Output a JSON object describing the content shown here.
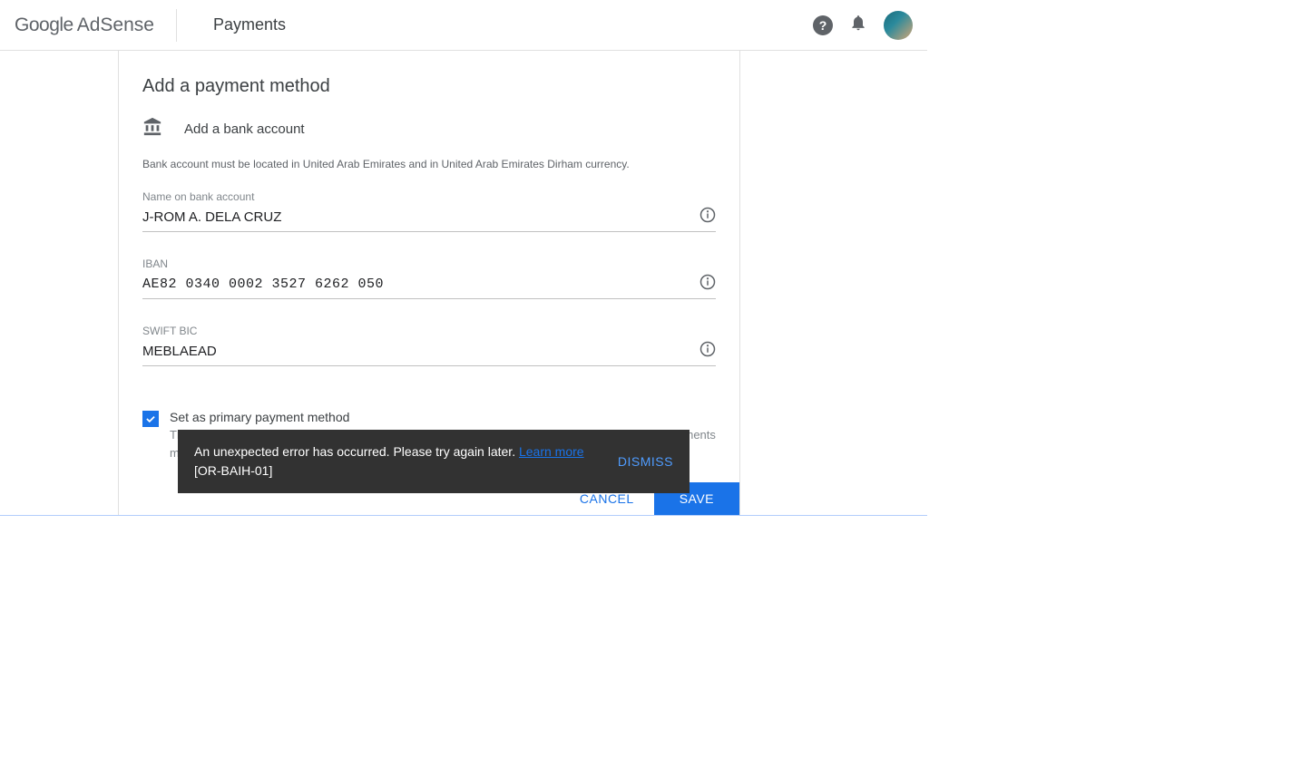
{
  "header": {
    "logo_part1": "Google",
    "logo_part2": "AdSense",
    "title": "Payments"
  },
  "card": {
    "title": "Add a payment method",
    "subtitle": "Add a bank account",
    "requirement": "Bank account must be located in United Arab Emirates and in United Arab Emirates Dirham currency.",
    "fields": {
      "name": {
        "label": "Name on bank account",
        "value": "J-ROM A. DELA CRUZ"
      },
      "iban": {
        "label": "IBAN",
        "value": "AE82 0340 0002 3527 6262 050"
      },
      "swift": {
        "label": "SWIFT BIC",
        "value": "MEBLAEAD"
      }
    },
    "checkbox": {
      "checked": true,
      "label": "Set as primary payment method",
      "help": "This payment method may need to be verified. If you make this your primary payment method, payments ma"
    },
    "buttons": {
      "cancel": "CANCEL",
      "save": "SAVE"
    }
  },
  "toast": {
    "message": "An unexpected error has occurred. Please try again later. ",
    "link_text": "Learn more",
    "error_code": "[OR-BAIH-01]",
    "dismiss": "DISMISS"
  }
}
